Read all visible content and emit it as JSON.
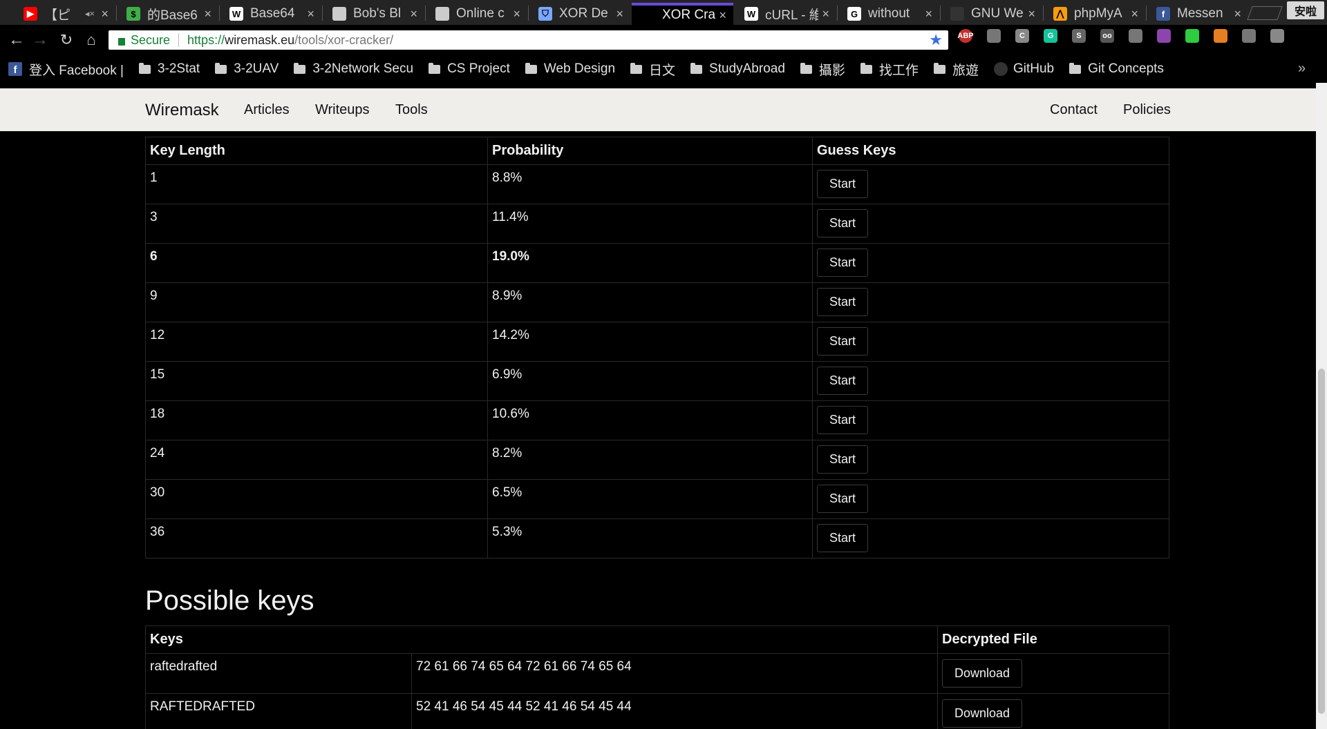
{
  "browser": {
    "tabs": [
      {
        "title": "【ピ",
        "favicon": "youtube-icon",
        "color": "#ff0000",
        "glyph": "▶",
        "audio": "◂×"
      },
      {
        "title": "的Base6",
        "favicon": "dollar-icon",
        "color": "#3fae49",
        "glyph": "$"
      },
      {
        "title": "Base64",
        "favicon": "wikipedia-icon",
        "color": "#ffffff",
        "glyph": "W"
      },
      {
        "title": "Bob's Bl",
        "favicon": "page-icon",
        "color": "#cccccc",
        "glyph": ""
      },
      {
        "title": "Online c",
        "favicon": "page-icon",
        "color": "#cccccc",
        "glyph": ""
      },
      {
        "title": "XOR De",
        "favicon": "ufo-icon",
        "color": "#7aa7ff",
        "glyph": "⛉"
      },
      {
        "title": "XOR Cra",
        "favicon": "wiremask-icon",
        "color": "#000000",
        "glyph": "",
        "active": true
      },
      {
        "title": "cURL - 維",
        "favicon": "wikipedia-icon",
        "color": "#ffffff",
        "glyph": "W"
      },
      {
        "title": "without",
        "favicon": "google-icon",
        "color": "#ffffff",
        "glyph": "G"
      },
      {
        "title": "GNU We",
        "favicon": "gnu-icon",
        "color": "#333333",
        "glyph": ""
      },
      {
        "title": "phpMyA",
        "favicon": "phpmyadmin-icon",
        "color": "#f89c0e",
        "glyph": "⋀"
      },
      {
        "title": "Messen",
        "favicon": "facebook-icon",
        "color": "#3b5998",
        "glyph": "f"
      }
    ],
    "close_glyph": "×",
    "profile_label": "安啦",
    "omnibox": {
      "secure_label": "Secure",
      "url_scheme": "https://",
      "url_host": "wiremask.eu",
      "url_path": "/tools/xor-cracker/"
    },
    "extensions": [
      {
        "name": "adblock-icon",
        "color": "#c4302b",
        "label": "ABP"
      },
      {
        "name": "extension-icon",
        "color": "#777777",
        "label": ""
      },
      {
        "name": "extension-icon",
        "color": "#888888",
        "label": "C"
      },
      {
        "name": "grammarly-icon",
        "color": "#15c39a",
        "label": "G"
      },
      {
        "name": "extension-icon",
        "color": "#666666",
        "label": "S"
      },
      {
        "name": "extension-icon",
        "color": "#555555",
        "label": "oo"
      },
      {
        "name": "extension-icon",
        "color": "#777777",
        "label": ""
      },
      {
        "name": "extension-icon",
        "color": "#8e44ad",
        "label": ""
      },
      {
        "name": "share-icon",
        "color": "#2ecc40",
        "label": ""
      },
      {
        "name": "extension-icon",
        "color": "#e67e22",
        "label": ""
      },
      {
        "name": "extension-icon",
        "color": "#777777",
        "label": ""
      },
      {
        "name": "extension-icon",
        "color": "#888888",
        "label": ""
      }
    ],
    "bookmarks": [
      {
        "label": "登入 Facebook |",
        "icon": "facebook-icon"
      },
      {
        "label": "3-2Stat",
        "icon": "folder-icon"
      },
      {
        "label": "3-2UAV",
        "icon": "folder-icon"
      },
      {
        "label": "3-2Network Secu",
        "icon": "folder-icon"
      },
      {
        "label": "CS Project",
        "icon": "folder-icon"
      },
      {
        "label": "Web Design",
        "icon": "folder-icon"
      },
      {
        "label": "日文",
        "icon": "folder-icon"
      },
      {
        "label": "StudyAbroad",
        "icon": "folder-icon"
      },
      {
        "label": "攝影",
        "icon": "folder-icon"
      },
      {
        "label": "找工作",
        "icon": "folder-icon"
      },
      {
        "label": "旅遊",
        "icon": "folder-icon"
      },
      {
        "label": "GitHub",
        "icon": "github-icon"
      },
      {
        "label": "Git Concepts",
        "icon": "folder-icon"
      }
    ],
    "more_glyph": "»"
  },
  "site": {
    "brand": "Wiremask",
    "nav_left": [
      "Articles",
      "Writeups",
      "Tools"
    ],
    "nav_right": [
      "Contact",
      "Policies"
    ]
  },
  "key_length_table": {
    "headers": [
      "Key Length",
      "Probability",
      "Guess Keys"
    ],
    "button_label": "Start",
    "rows": [
      {
        "length": "1",
        "probability": "8.8%"
      },
      {
        "length": "3",
        "probability": "11.4%"
      },
      {
        "length": "6",
        "probability": "19.0%",
        "highlight": true
      },
      {
        "length": "9",
        "probability": "8.9%"
      },
      {
        "length": "12",
        "probability": "14.2%"
      },
      {
        "length": "15",
        "probability": "6.9%"
      },
      {
        "length": "18",
        "probability": "10.6%"
      },
      {
        "length": "24",
        "probability": "8.2%"
      },
      {
        "length": "30",
        "probability": "6.5%"
      },
      {
        "length": "36",
        "probability": "5.3%"
      }
    ]
  },
  "possible_keys": {
    "heading": "Possible keys",
    "headers": [
      "Keys",
      "Decrypted File"
    ],
    "button_label": "Download",
    "rows": [
      {
        "key": "raftedrafted",
        "hex": "72 61 66 74 65 64 72 61 66 74 65 64"
      },
      {
        "key": "RAFTEDRAFTED",
        "hex": "52 41 46 54 45 44 52 41 46 54 45 44"
      }
    ]
  }
}
